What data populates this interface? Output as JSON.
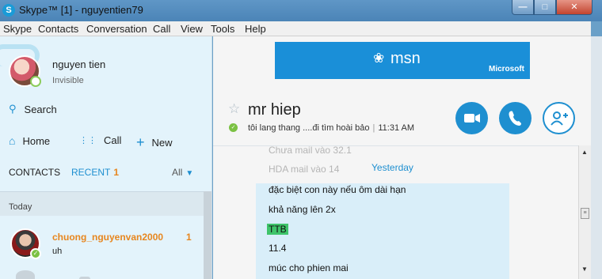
{
  "window": {
    "title": "Skype™ [1] - nguyentien79",
    "app_icon": "S",
    "controls": [
      "minimize-icon",
      "maximize-icon",
      "close-icon"
    ]
  },
  "menu": [
    "Skype",
    "Contacts",
    "Conversation",
    "Call",
    "View",
    "Tools",
    "Help"
  ],
  "profile": {
    "name": "nguyen tien",
    "status": "Invisible"
  },
  "sidebar": {
    "search_label": "Search",
    "nav": [
      {
        "label": "Home",
        "icon": "home-icon"
      },
      {
        "label": "Call",
        "icon": "dialpad-icon"
      },
      {
        "label": "New",
        "icon": "plus-icon"
      }
    ],
    "tabs": {
      "contacts": "CONTACTS",
      "recent": "RECENT",
      "recent_count": "1",
      "filter": "All"
    },
    "group_label": "Today",
    "conversations": [
      {
        "name": "chuong_nguyenvan2000",
        "preview": "uh",
        "unread": "1"
      }
    ]
  },
  "ad": {
    "brand": "msn",
    "sponsor": "Microsoft",
    "color": "#1a8fd8"
  },
  "chat": {
    "contact_name": "mr hiep",
    "mood": "tôi lang thang ....đi tìm hoài bảo",
    "time": "11:31 AM",
    "actions": [
      "video-call-button",
      "audio-call-button",
      "add-people-button"
    ],
    "faded_lines": [
      "Chưa mail vào 32.1",
      "HDA mail vào 14"
    ],
    "day_separator": "Yesterday",
    "messages": [
      {
        "text": "đặc biệt con này nếu ôm dài hạn"
      },
      {
        "text": "khả năng lên 2x"
      },
      {
        "text": "TTB",
        "highlight": true
      },
      {
        "text": "11.4"
      },
      {
        "text": "múc cho phien mai"
      }
    ]
  },
  "colors": {
    "accent": "#1e8fd0",
    "unread": "#e7861e",
    "online": "#7bc143",
    "highlight": "#3fc46a"
  }
}
